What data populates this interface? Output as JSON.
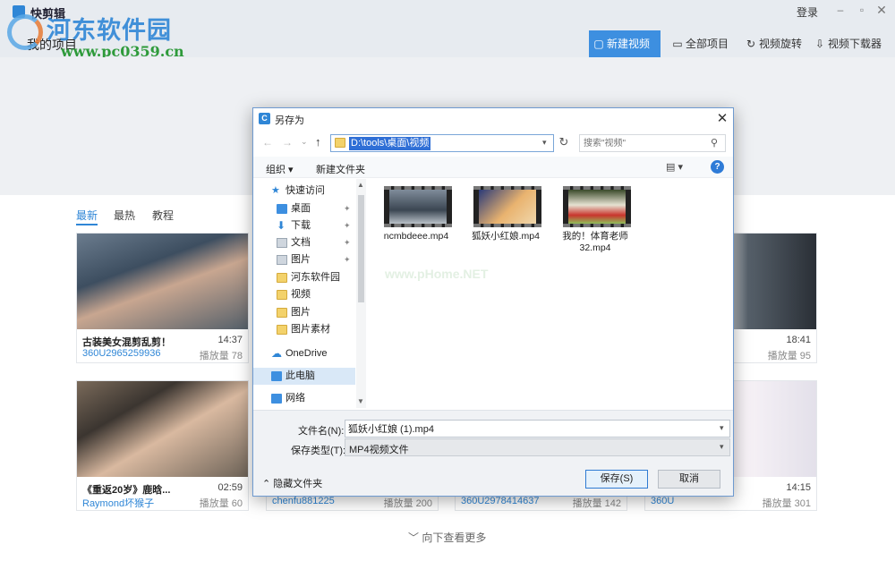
{
  "app": {
    "title": "快剪辑",
    "my_projects": "我的项目",
    "login": "登录",
    "window_controls": {
      "minimize": "–",
      "maximize": "▫",
      "close": "✕"
    },
    "toolbar": {
      "new_video": "新建视频",
      "all_projects": "全部项目",
      "rotate_video": "视频旋转",
      "video_downloader": "视频下载器"
    },
    "icons": {
      "new_video": "▢",
      "all_projects": "▭",
      "rotate_video": "↻",
      "video_downloader": "⇩"
    },
    "accent_color": "#3d8fe0"
  },
  "watermark": {
    "name": "河东软件园",
    "url": "www.pc0359.cn"
  },
  "content_tabs": {
    "latest": "最新",
    "hot": "最热",
    "tutorial": "教程"
  },
  "cards": [
    {
      "title": "古装美女混剪乱剪！",
      "duration": "14:37",
      "author": "360U2965259936",
      "plays": "播放量 78"
    },
    {
      "title": "…",
      "duration": "18:41",
      "author": "",
      "plays": "播放量 95"
    },
    {
      "title": "《重返20岁》鹿晗...",
      "duration": "02:59",
      "author": "Raymond坏猴子",
      "plays": "播放量 60"
    },
    {
      "title": "",
      "duration": "",
      "author": "chenfu881225",
      "plays": "播放量 200"
    },
    {
      "title": "",
      "duration": "",
      "author": "360U2978414637",
      "plays": "播放量 142"
    },
    {
      "title": "…",
      "duration": "14:15",
      "author": "360U",
      "plays": "播放量 301"
    }
  ],
  "load_more": "﹀ 向下查看更多",
  "dialog": {
    "title": "另存为",
    "app_icon": "C",
    "close": "✕",
    "nav": {
      "back": "←",
      "forward": "→",
      "dropdown": "⌄",
      "up": "↑",
      "refresh": "↻"
    },
    "address": "D:\\tools\\桌面\\视频",
    "search_placeholder": "搜索\"视频\"",
    "search_icon": "⚲",
    "organize": "组织 ▾",
    "new_folder": "新建文件夹",
    "view_icon": "▤ ▾",
    "help_icon": "?",
    "nav_pane": {
      "quick_access": "快速访问",
      "desktop": "桌面",
      "downloads": "下载",
      "documents": "文档",
      "pictures": "图片",
      "hedong": "河东软件园",
      "videos": "视频",
      "pictures2": "图片",
      "picture_material": "图片素材",
      "onedrive": "OneDrive",
      "this_pc": "此电脑",
      "network": "网络",
      "pin": "✦"
    },
    "files": [
      {
        "name": "ncmbdeee.mp4"
      },
      {
        "name": "狐妖小红娘.mp4"
      },
      {
        "name": "我的！体育老师32.mp4"
      }
    ],
    "pane_watermark": "www.pHome.NET",
    "filename_label": "文件名(N):",
    "filename_value": "狐妖小红娘 (1).mp4",
    "filetype_label": "保存类型(T):",
    "filetype_value": "MP4视频文件",
    "hide_folders": "⌃ 隐藏文件夹",
    "save": "保存(S)",
    "cancel": "取消"
  }
}
